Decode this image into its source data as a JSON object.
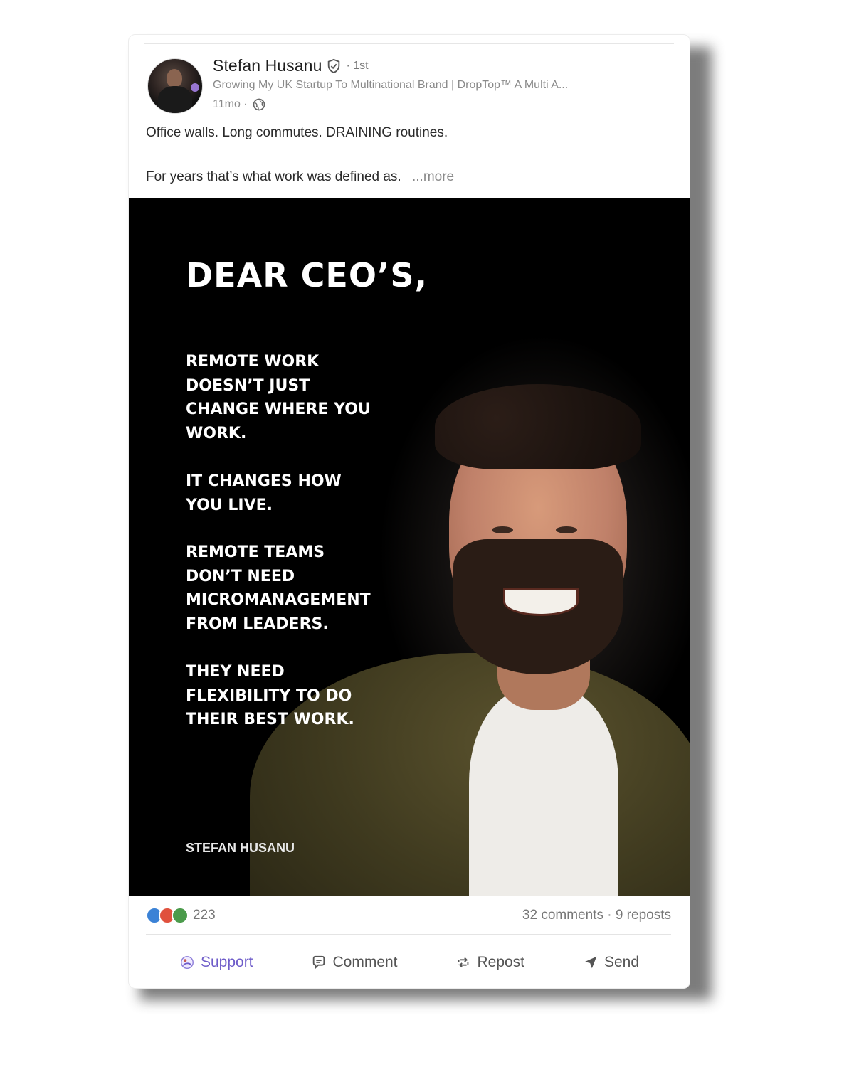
{
  "author": {
    "name": "Stefan Husanu",
    "degree": "· 1st",
    "headline": "Growing My UK Startup To Multinational Brand | DropTop™ A Multi A...",
    "time": "11mo ·"
  },
  "post": {
    "line1": "Office walls. Long commutes. DRAINING routines.",
    "line2": "For years that’s what work was defined as.",
    "more": "...more"
  },
  "image": {
    "title": "DEAR CEO’S,",
    "block1": "REMOTE WORK\nDOESN’T JUST\nCHANGE WHERE YOU\nWORK.",
    "block2": "IT CHANGES HOW\nYOU LIVE.",
    "block3": "REMOTE TEAMS\nDON’T NEED\nMICROMANAGEMENT\nFROM LEADERS.",
    "block4": "THEY NEED\nFLEXIBILITY TO DO\nTHEIR BEST WORK.",
    "signature": "STEFAN HUSANU"
  },
  "social": {
    "reactions_count": "223",
    "comments_reposts": "32 comments · 9 reposts"
  },
  "actions": {
    "support": "Support",
    "comment": "Comment",
    "repost": "Repost",
    "send": "Send"
  },
  "colors": {
    "support_accent": "#6e5cc9",
    "reaction_like": "#3b82d6",
    "reaction_love": "#e0513d",
    "reaction_support": "#4b9b4b"
  }
}
